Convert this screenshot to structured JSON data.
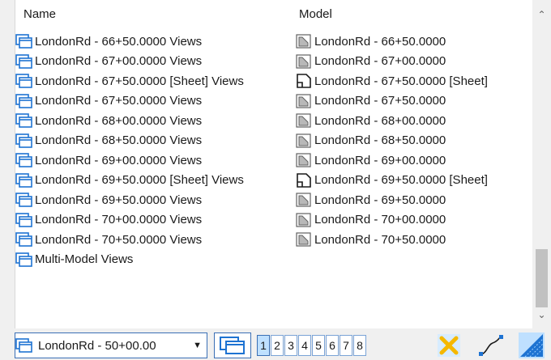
{
  "columns": {
    "name": "Name",
    "model": "Model"
  },
  "rows": [
    {
      "name": "LondonRd - 66+50.0000 Views",
      "model": "LondonRd - 66+50.0000",
      "model_icon": "design-model-icon"
    },
    {
      "name": "LondonRd - 67+00.0000 Views",
      "model": "LondonRd - 67+00.0000",
      "model_icon": "design-model-icon"
    },
    {
      "name": "LondonRd - 67+50.0000 [Sheet] Views",
      "model": "LondonRd - 67+50.0000 [Sheet]",
      "model_icon": "sheet-model-icon"
    },
    {
      "name": "LondonRd - 67+50.0000 Views",
      "model": "LondonRd - 67+50.0000",
      "model_icon": "design-model-icon"
    },
    {
      "name": "LondonRd - 68+00.0000 Views",
      "model": "LondonRd - 68+00.0000",
      "model_icon": "design-model-icon"
    },
    {
      "name": "LondonRd - 68+50.0000 Views",
      "model": "LondonRd - 68+50.0000",
      "model_icon": "design-model-icon"
    },
    {
      "name": "LondonRd - 69+00.0000 Views",
      "model": "LondonRd - 69+00.0000",
      "model_icon": "design-model-icon"
    },
    {
      "name": "LondonRd - 69+50.0000 [Sheet] Views",
      "model": "LondonRd - 69+50.0000 [Sheet]",
      "model_icon": "sheet-model-icon"
    },
    {
      "name": "LondonRd - 69+50.0000 Views",
      "model": "LondonRd - 69+50.0000",
      "model_icon": "design-model-icon"
    },
    {
      "name": "LondonRd - 70+00.0000 Views",
      "model": "LondonRd - 70+00.0000",
      "model_icon": "design-model-icon"
    },
    {
      "name": "LondonRd - 70+50.0000 Views",
      "model": "LondonRd - 70+50.0000",
      "model_icon": "design-model-icon"
    },
    {
      "name": "Multi-Model Views",
      "model": "",
      "model_icon": ""
    }
  ],
  "toolbar": {
    "combo_value": "LondonRd - 50+00.00",
    "view_numbers": [
      "1",
      "2",
      "3",
      "4",
      "5",
      "6",
      "7",
      "8"
    ],
    "active_view": "1"
  },
  "colors": {
    "accent": "#1e73d2",
    "active_view_bg": "#bfe0ff"
  }
}
